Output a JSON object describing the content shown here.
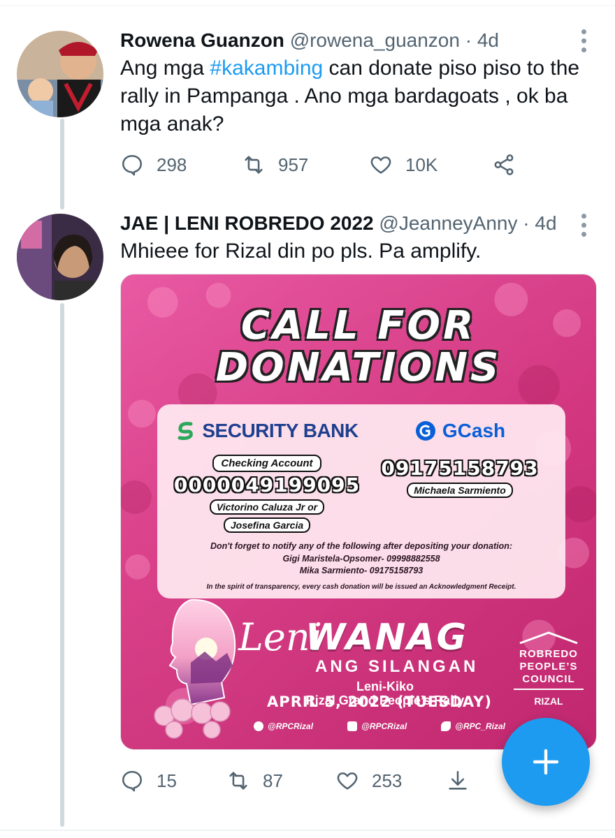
{
  "tweets": [
    {
      "name": "Rowena Guanzon",
      "handle": "@rowena_guanzon",
      "dot": "·",
      "time": "4d",
      "text_before": "Ang mga ",
      "hashtag": "#kakambing",
      "text_after": " can donate piso piso to the rally in Pampanga . Ano mga bardagoats , ok ba mga anak?",
      "replies": "298",
      "retweets": "957",
      "likes": "10K"
    },
    {
      "name": "JAE | LENI ROBREDO 2022",
      "handle": "@JeanneyAnny",
      "dot": "·",
      "time": "4d",
      "text": "Mhieee for Rizal din po pls. Pa amplify.",
      "replies": "15",
      "retweets": "87",
      "likes": "253"
    }
  ],
  "poster": {
    "headline_1": "CALL FOR",
    "headline_2": "DONATIONS",
    "bank": {
      "brand": "SECURITY BANK",
      "account_type": "Checking Account",
      "account_number": "0000049199095",
      "holder_1": "Victorino Caluza Jr or",
      "holder_2": "Josefina Garcia"
    },
    "gcash": {
      "brand": "GCash",
      "number": "09175158793",
      "holder": "Michaela Sarmiento"
    },
    "notice_1": "Don't forget to notify any of the following after depositing your donation:",
    "notice_2": "Gigi Maristela-Opsomer- 09998882558",
    "notice_3": "Mika Sarmiento- 09175158793",
    "notice_4": "In the spirit of transparency, every cash donation will be issued an Acknowledgment Receipt.",
    "event_script": "Leni",
    "event_word": "WANAG",
    "event_sub": "ANG SILANGAN",
    "event_line_1": "Leni-Kiko",
    "event_line_2": "Rizal Grand People’s Rally",
    "event_date": "APRIL 5, 2022 (TUESDAY)",
    "council_1": "ROBREDO",
    "council_2": "PEOPLE’S",
    "council_3": "COUNCIL",
    "council_4": "RIZAL",
    "social_fb": "@RPCRizal",
    "social_ig": "@RPCRizal",
    "social_tw": "@RPC_Rizal"
  },
  "colors": {
    "link": "#1d9bf0",
    "secondary_text": "#536471",
    "poster_pink": "#d6337f",
    "fab": "#1d9bf0"
  },
  "icons": [
    "reply-icon",
    "retweet-icon",
    "like-icon",
    "share-icon",
    "download-icon",
    "more-icon",
    "compose-plus-icon"
  ]
}
